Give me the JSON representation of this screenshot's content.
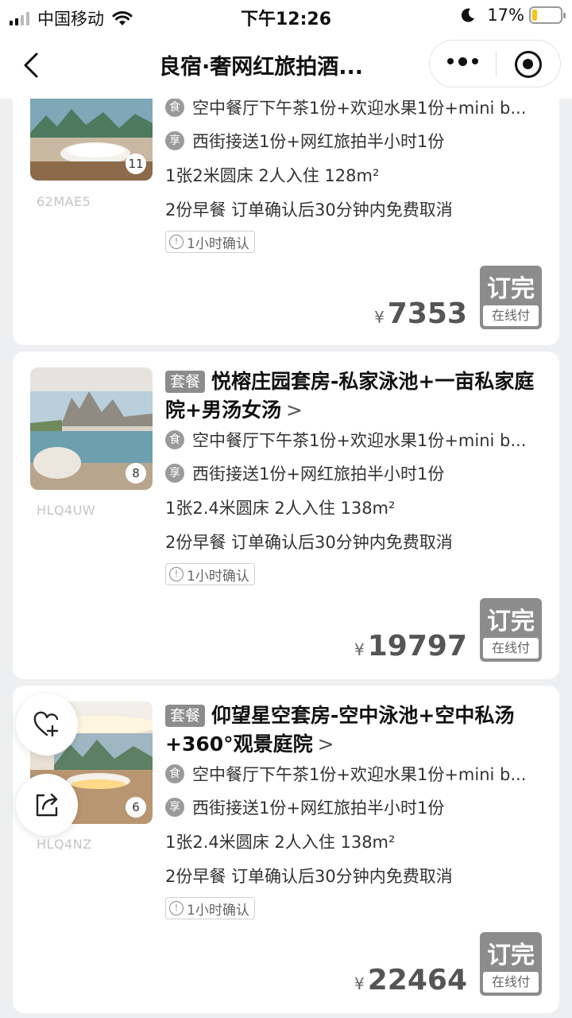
{
  "status_bar": {
    "carrier": "中国移动",
    "time": "下午12:26",
    "battery_percent": "17%",
    "battery_level": 0.17
  },
  "nav": {
    "title": "良宿·奢网红旅拍酒..."
  },
  "rooms": [
    {
      "title": "",
      "photo_count": "11",
      "code": "62MAE5",
      "meal": "空中餐厅下午茶1份+欢迎水果1份+mini b...",
      "meal_icon": "食",
      "perk": "西街接送1份+网红旅拍半小时1份",
      "perk_icon": "享",
      "spec": "1张2米圆床  2人入住  128m²",
      "policy": "2份早餐  订单确认后30分钟内免费取消",
      "confirm": "1小时确认",
      "currency": "¥",
      "price": "7353",
      "book_label": "订完",
      "pay_label": "在线付"
    },
    {
      "tag": "套餐",
      "title": "悦榕庄园套房-私家泳池+一亩私家庭院+男汤女汤",
      "photo_count": "8",
      "code": "HLQ4UW",
      "meal": "空中餐厅下午茶1份+欢迎水果1份+mini b...",
      "meal_icon": "食",
      "perk": "西街接送1份+网红旅拍半小时1份",
      "perk_icon": "享",
      "spec": "1张2.4米圆床  2人入住  138m²",
      "policy": "2份早餐  订单确认后30分钟内免费取消",
      "confirm": "1小时确认",
      "currency": "¥",
      "price": "19797",
      "book_label": "订完",
      "pay_label": "在线付"
    },
    {
      "tag": "套餐",
      "title": "仰望星空套房-空中泳池+空中私汤+360°观景庭院",
      "photo_count": "6",
      "code": "HLQ4NZ",
      "meal": "空中餐厅下午茶1份+欢迎水果1份+mini b...",
      "meal_icon": "食",
      "perk": "西街接送1份+网红旅拍半小时1份",
      "perk_icon": "享",
      "spec": "1张2.4米圆床  2人入住  138m²",
      "policy": "2份早餐  订单确认后30分钟内免费取消",
      "confirm": "1小时确认",
      "currency": "¥",
      "price": "22464",
      "book_label": "订完",
      "pay_label": "在线付"
    }
  ],
  "chevron": ">",
  "icons": {
    "favorite": "heart-plus-icon",
    "share": "share-icon",
    "back": "chevron-left-icon",
    "more": "more-dots-icon",
    "close_miniprogram": "target-icon"
  }
}
